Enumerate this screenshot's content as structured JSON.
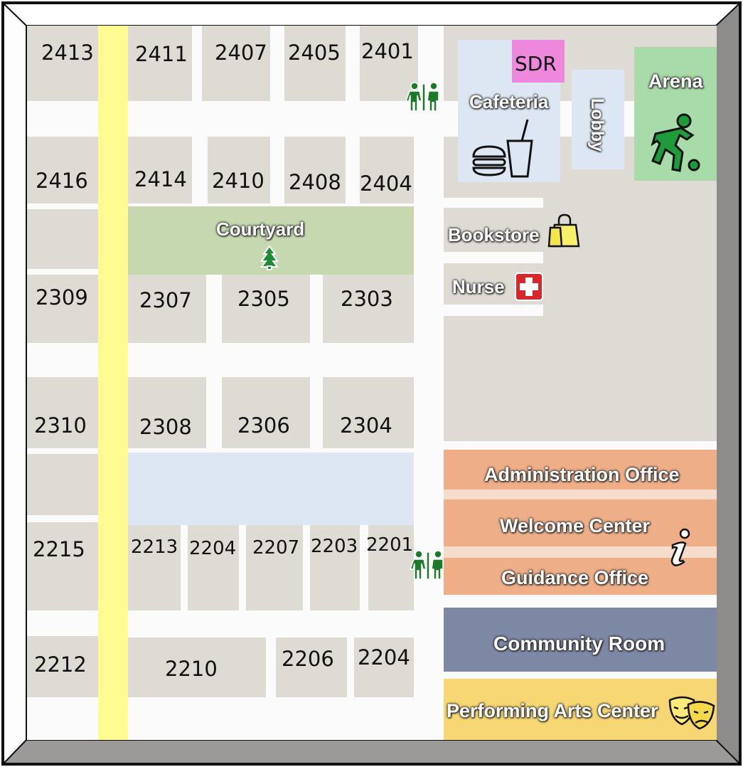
{
  "map": {
    "rooms": {
      "r2413": "2413",
      "r2411": "2411",
      "r2407": "2407",
      "r2405": "2405",
      "r2401": "2401",
      "r2416": "2416",
      "r2414": "2414",
      "r2410": "2410",
      "r2408": "2408",
      "r2404": "2404",
      "r2309": "2309",
      "r2307": "2307",
      "r2305": "2305",
      "r2303": "2303",
      "r2310": "2310",
      "r2308": "2308",
      "r2306": "2306",
      "r2304": "2304",
      "r2215": "2215",
      "r2213": "2213",
      "r2204a": "2204",
      "r2207": "2207",
      "r2203": "2203",
      "r2201": "2201",
      "r2212": "2212",
      "r2210": "2210",
      "r2206": "2206",
      "r2204b": "2204"
    },
    "areas": {
      "courtyard": "Courtyard",
      "cafeteria": "Cafeteria",
      "sdr": "SDR",
      "lobby": "Lobby",
      "arena": "Arena",
      "bookstore": "Bookstore",
      "nurse": "Nurse",
      "administration": "Administration Office",
      "welcome": "Welcome Center",
      "guidance": "Guidance Office",
      "community": "Community Room",
      "performing_arts": "Performing Arts Center"
    },
    "icons": [
      "restroom-icon",
      "restroom-icon",
      "food-icon",
      "soccer-player-icon",
      "tree-icon",
      "shopping-bag-icon",
      "first-aid-icon",
      "info-icon",
      "theater-masks-icon"
    ],
    "colors": {
      "hallway": "#fbfbfb",
      "room": "#dedad4",
      "main_corridor": "#fdfb92",
      "courtyard": "#c5d8b0",
      "open_area": "#dde7f3",
      "cafeteria": "#dde7f3",
      "sdr": "#ee88dc",
      "arena": "#a9daa9",
      "offices": "#eeaf88",
      "community_room": "#7d88a4",
      "performing_arts": "#f7d773",
      "frame": "#9a9a9a"
    }
  }
}
